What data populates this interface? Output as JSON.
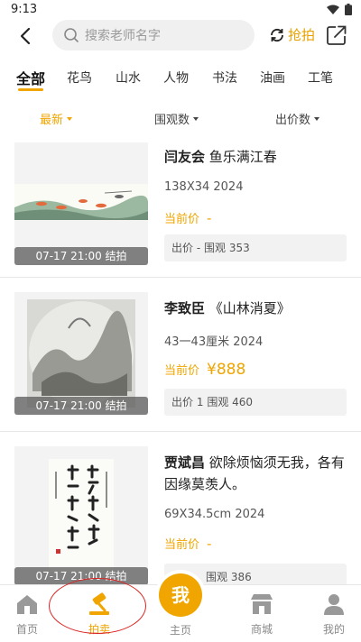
{
  "status": {
    "time": "9:13"
  },
  "header": {
    "search_placeholder": "搜索老师名字",
    "grab_label": "抢拍"
  },
  "categories": [
    "全部",
    "花鸟",
    "山水",
    "人物",
    "书法",
    "油画",
    "工笔"
  ],
  "sort": {
    "latest": "最新",
    "views": "围观数",
    "bids": "出价数"
  },
  "items": [
    {
      "artist": "闫友会",
      "title": "鱼乐满江春",
      "spec": "138X34 2024",
      "price_label": "当前价",
      "price": "-",
      "bid_label": "出价",
      "bid_count": "-",
      "views_label": "围观",
      "views": "353",
      "end": "07-17 21:00 结拍"
    },
    {
      "artist": "李致臣",
      "title": "《山林消夏》",
      "spec": "43一43厘米 2024",
      "price_label": "当前价",
      "price": "¥888",
      "bid_label": "出价",
      "bid_count": "1",
      "views_label": "围观",
      "views": "460",
      "end": "07-17 21:00 结拍"
    },
    {
      "artist": "贾斌昌",
      "title": "欲除烦恼须无我，各有因缘莫羡人。",
      "spec": "69X34.5cm 2024",
      "price_label": "当前价",
      "price": "-",
      "bid_label": "",
      "bid_count": "",
      "views_label": "围观",
      "views": "386",
      "end": "07-17 21:00 结拍"
    }
  ],
  "tabbar": {
    "home": "首页",
    "auction": "拍卖",
    "main": "主页",
    "main_btn": "我",
    "mall": "商城",
    "mine": "我的"
  },
  "colors": {
    "accent": "#f0a500",
    "annotation": "#dd2222"
  }
}
